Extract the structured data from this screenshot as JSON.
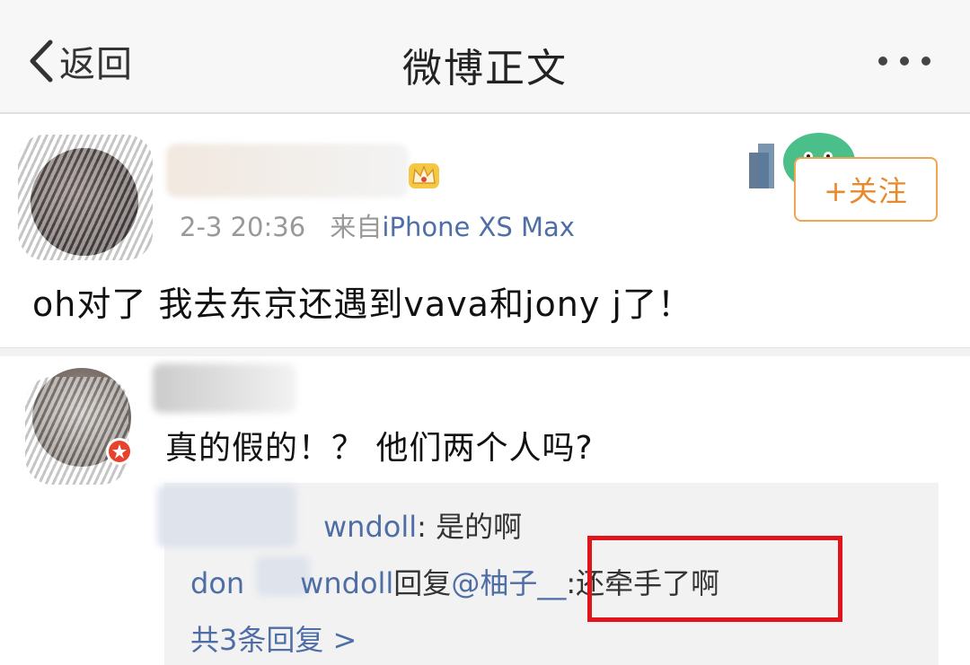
{
  "navbar": {
    "back_label": "返回",
    "title": "微博正文",
    "back_icon": "chevron-left-icon",
    "more_icon": "more-dots-icon"
  },
  "post": {
    "timestamp": "2-3 20:36",
    "source_prefix": "来自",
    "source": "iPhone XS Max",
    "follow_label": "+关注",
    "text": "oh对了 我去东京还遇到vava和jony j了！",
    "crown_icon": "crown-badge-icon"
  },
  "comment": {
    "text": "真的假的！？ 他们两个人吗?",
    "replies": [
      {
        "user": "wndoll",
        "separator": ": ",
        "text": "是的啊"
      },
      {
        "user_prefix": "don",
        "user": "wndoll",
        "action": "回复",
        "mention": "@柚子__",
        "separator": ":",
        "text": "还牵手了啊"
      }
    ],
    "more_replies": "共3条回复 >"
  },
  "colors": {
    "link": "#4e6ea5",
    "follow": "#e8892b",
    "highlight": "#e2141b",
    "reply_bg": "#f2f2f2"
  }
}
